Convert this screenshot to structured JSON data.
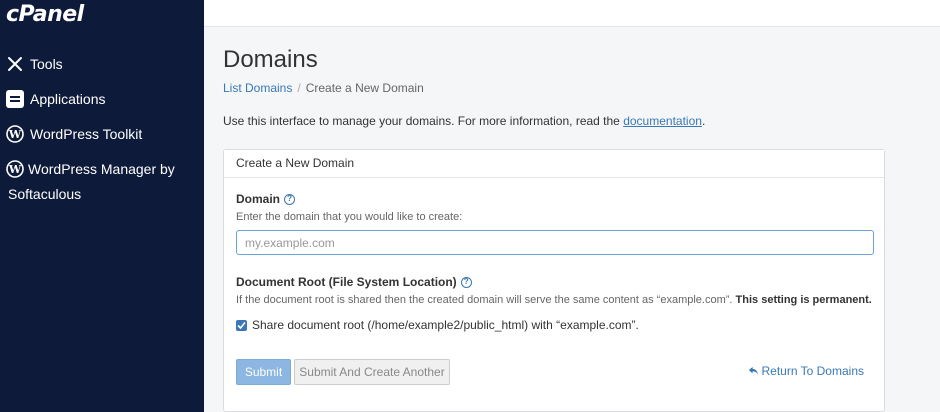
{
  "sidebar": {
    "logo": "cPanel",
    "items": [
      {
        "label": "Tools",
        "icon": "tools-icon"
      },
      {
        "label": "Applications",
        "icon": "applications-icon"
      },
      {
        "label": "WordPress Toolkit",
        "icon": "wordpress-icon"
      },
      {
        "label": "WordPress Manager by Softaculous",
        "icon": "wordpress-icon"
      }
    ]
  },
  "page": {
    "title": "Domains",
    "breadcrumb": {
      "parent": "List Domains",
      "separator": "/",
      "current": "Create a New Domain"
    },
    "intro_text": "Use this interface to manage your domains. For more information, read the ",
    "intro_link": "documentation",
    "intro_end": "."
  },
  "form": {
    "panel_title": "Create a New Domain",
    "domain_label": "Domain",
    "domain_help": "Enter the domain that you would like to create:",
    "domain_placeholder": "my.example.com",
    "domain_value": "",
    "docroot_label": "Document Root (File System Location)",
    "docroot_help": "If the document root is shared then the created domain will serve the same content as “example.com”.",
    "docroot_help_strong": "This setting is permanent.",
    "share_checkbox_label": "Share document root (/home/example2/public_html) with “example.com”.",
    "share_checked": true,
    "submit_label": "Submit",
    "submit_another_label": "Submit And Create Another",
    "return_label": "Return To Domains"
  },
  "colors": {
    "sidebar_bg": "#0e1a3a",
    "accent": "#3a78b5",
    "submit_bg": "#8cb7e2"
  }
}
